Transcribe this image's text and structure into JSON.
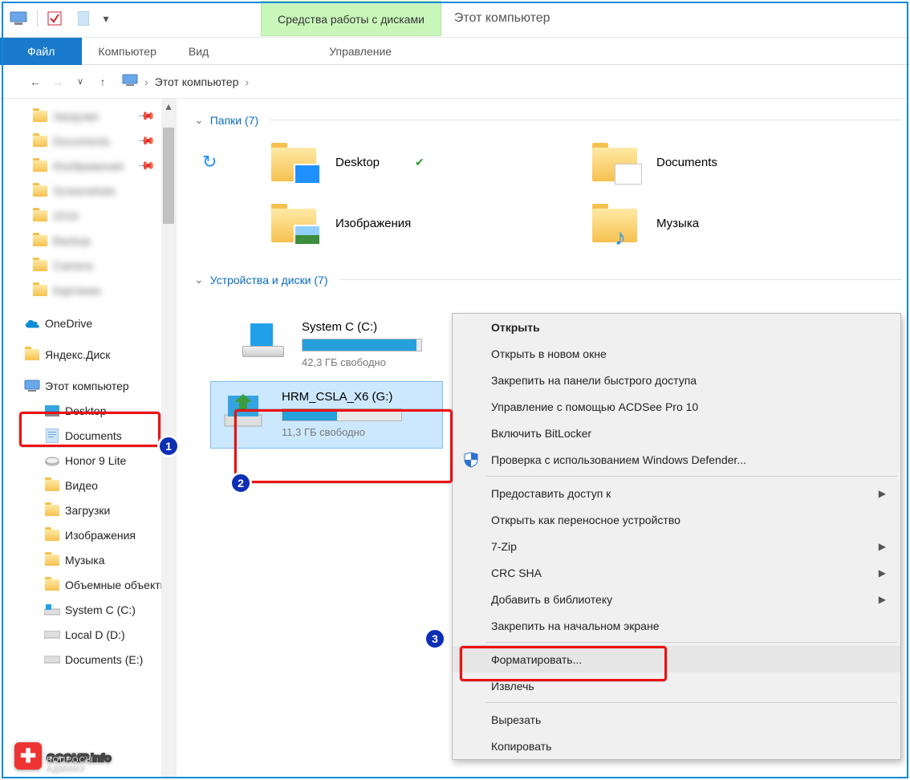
{
  "title": "Этот компьютер",
  "disk_tools_tab": "Средства работы с дисками",
  "ribbon": {
    "file": "Файл",
    "computer": "Компьютер",
    "view": "Вид",
    "manage": "Управление"
  },
  "breadcrumb": {
    "root": "Этот компьютер"
  },
  "sidebar": {
    "blurred": [
      "Загрузки",
      "Documents",
      "Изображения",
      "Screenshots",
      "2019",
      "Backup",
      "Camera",
      "Картинки"
    ],
    "onedrive": "OneDrive",
    "yandex": "Яндекс.Диск",
    "this_pc": "Этот компьютер",
    "children": [
      "Desktop",
      "Documents",
      "Honor 9 Lite",
      "Видео",
      "Загрузки",
      "Изображения",
      "Музыка",
      "Объемные объекты",
      "System C (C:)",
      "Local D (D:)",
      "Documents (E:)"
    ]
  },
  "groups": {
    "folders_header": "Папки (7)",
    "drives_header": "Устройства и диски (7)"
  },
  "folders": {
    "desktop": "Desktop",
    "documents": "Documents",
    "pictures": "Изображения",
    "music": "Музыка"
  },
  "drives": {
    "c": {
      "name": "System C (C:)",
      "free": "42,3 ГБ свободно",
      "fill": 96
    },
    "g": {
      "name": "HRM_CSLA_X6 (G:)",
      "free": "11,3 ГБ свободно",
      "fill": 46
    }
  },
  "ctx": {
    "open": "Открыть",
    "open_new": "Открыть в новом окне",
    "pin_quick": "Закрепить на панели быстрого доступа",
    "acdsee": "Управление с помощью ACDSee Pro 10",
    "bitlocker": "Включить BitLocker",
    "defender": "Проверка с использованием Windows Defender...",
    "share": "Предоставить доступ к",
    "portable": "Открыть как переносное устройство",
    "7zip": "7-Zip",
    "crc": "CRC SHA",
    "library": "Добавить в библиотеку",
    "pin_start": "Закрепить на начальном экране",
    "format": "Форматировать...",
    "eject": "Извлечь",
    "cut": "Вырезать",
    "copy": "Копировать"
  },
  "annot": {
    "1": "1",
    "2": "2",
    "3": "3"
  },
  "watermark": {
    "main": "OCOMP",
    "suffix": ".info",
    "sub": "ВОПРОСЫ АДМИНУ"
  }
}
